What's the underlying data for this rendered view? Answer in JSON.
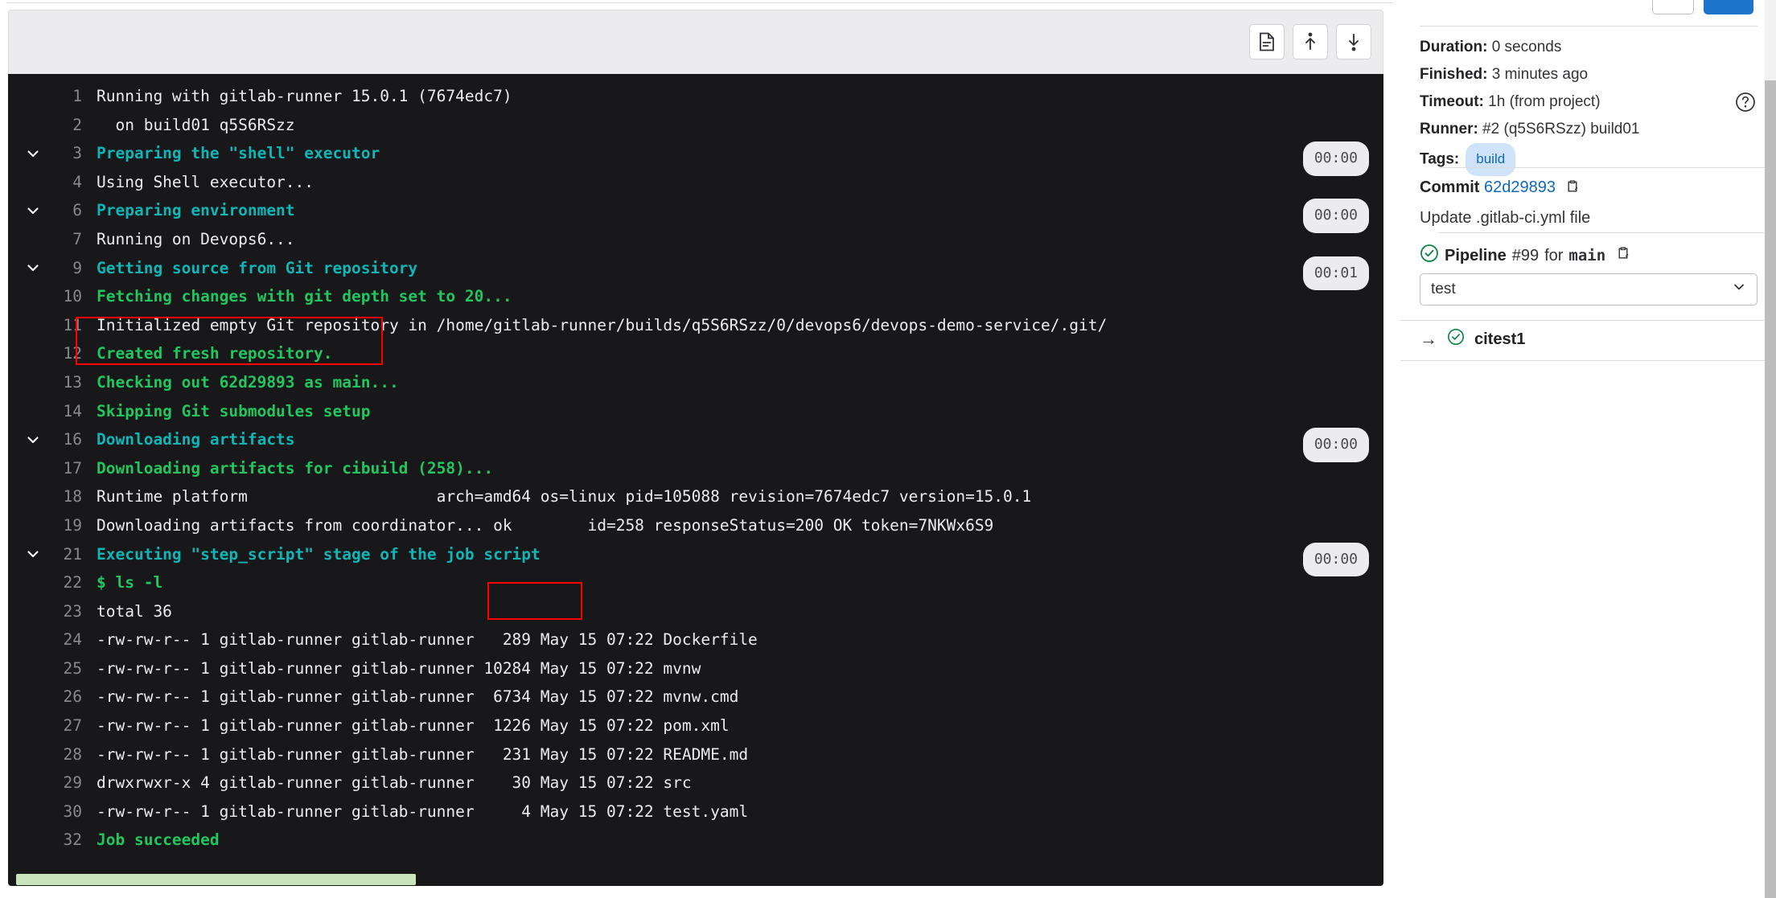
{
  "toolbar": {
    "buttons": [
      {
        "name": "raw-log-button",
        "icon": "document-icon",
        "label": "Show complete raw"
      },
      {
        "name": "scroll-to-top-button",
        "icon": "arrow-up-icon",
        "label": "Scroll to top"
      },
      {
        "name": "scroll-to-bottom-button",
        "icon": "arrow-down-icon",
        "label": "Scroll to bottom"
      }
    ]
  },
  "log": {
    "lines": [
      {
        "num": "1",
        "text": "Running with gitlab-runner 15.0.1 (7674edc7)",
        "style": "plain",
        "collapsible": false,
        "time": ""
      },
      {
        "num": "2",
        "text": "  on build01 q5S6RSzz",
        "style": "plain",
        "collapsible": false,
        "time": ""
      },
      {
        "num": "3",
        "text": "Preparing the \"shell\" executor",
        "style": "cyan",
        "collapsible": true,
        "time": "00:00"
      },
      {
        "num": "4",
        "text": "Using Shell executor...",
        "style": "plain",
        "collapsible": false,
        "time": ""
      },
      {
        "num": "6",
        "text": "Preparing environment",
        "style": "cyan",
        "collapsible": true,
        "time": "00:00"
      },
      {
        "num": "7",
        "text": "Running on Devops6...",
        "style": "plain",
        "collapsible": false,
        "time": ""
      },
      {
        "num": "9",
        "text": "Getting source from Git repository",
        "style": "cyan",
        "collapsible": true,
        "time": "00:01"
      },
      {
        "num": "10",
        "text": "Fetching changes with git depth set to 20...",
        "style": "green",
        "collapsible": false,
        "time": ""
      },
      {
        "num": "11",
        "text": "Initialized empty Git repository in /home/gitlab-runner/builds/q5S6RSzz/0/devops6/devops-demo-service/.git/",
        "style": "plain",
        "collapsible": false,
        "time": ""
      },
      {
        "num": "12",
        "text": "Created fresh repository.",
        "style": "green",
        "collapsible": false,
        "time": ""
      },
      {
        "num": "13",
        "text": "Checking out 62d29893 as main...",
        "style": "green",
        "collapsible": false,
        "time": ""
      },
      {
        "num": "14",
        "text": "Skipping Git submodules setup",
        "style": "green",
        "collapsible": false,
        "time": ""
      },
      {
        "num": "16",
        "text": "Downloading artifacts",
        "style": "cyan",
        "collapsible": true,
        "time": "00:00"
      },
      {
        "num": "17",
        "text": "Downloading artifacts for cibuild (258)...",
        "style": "green",
        "collapsible": false,
        "time": ""
      },
      {
        "num": "18",
        "text": "Runtime platform                    arch=amd64 os=linux pid=105088 revision=7674edc7 version=15.0.1",
        "style": "plain",
        "collapsible": false,
        "time": ""
      },
      {
        "num": "19",
        "text": "Downloading artifacts from coordinator... ok        id=258 responseStatus=200 OK token=7NKWx6S9",
        "style": "plain",
        "collapsible": false,
        "time": ""
      },
      {
        "num": "21",
        "text": "Executing \"step_script\" stage of the job script",
        "style": "cyan",
        "collapsible": true,
        "time": "00:00"
      },
      {
        "num": "22",
        "text": "$ ls -l",
        "style": "green",
        "collapsible": false,
        "time": ""
      },
      {
        "num": "23",
        "text": "total 36",
        "style": "plain",
        "collapsible": false,
        "time": ""
      },
      {
        "num": "24",
        "text": "-rw-rw-r-- 1 gitlab-runner gitlab-runner   289 May 15 07:22 Dockerfile",
        "style": "plain",
        "collapsible": false,
        "time": ""
      },
      {
        "num": "25",
        "text": "-rw-rw-r-- 1 gitlab-runner gitlab-runner 10284 May 15 07:22 mvnw",
        "style": "plain",
        "collapsible": false,
        "time": ""
      },
      {
        "num": "26",
        "text": "-rw-rw-r-- 1 gitlab-runner gitlab-runner  6734 May 15 07:22 mvnw.cmd",
        "style": "plain",
        "collapsible": false,
        "time": ""
      },
      {
        "num": "27",
        "text": "-rw-rw-r-- 1 gitlab-runner gitlab-runner  1226 May 15 07:22 pom.xml",
        "style": "plain",
        "collapsible": false,
        "time": ""
      },
      {
        "num": "28",
        "text": "-rw-rw-r-- 1 gitlab-runner gitlab-runner   231 May 15 07:22 README.md",
        "style": "plain",
        "collapsible": false,
        "time": ""
      },
      {
        "num": "29",
        "text": "drwxrwxr-x 4 gitlab-runner gitlab-runner    30 May 15 07:22 src",
        "style": "plain",
        "collapsible": false,
        "time": ""
      },
      {
        "num": "30",
        "text": "-rw-rw-r-- 1 gitlab-runner gitlab-runner     4 May 15 07:22 test.yaml",
        "style": "plain",
        "collapsible": false,
        "time": ""
      },
      {
        "num": "32",
        "text": "Job succeeded",
        "style": "green",
        "collapsible": false,
        "time": ""
      }
    ],
    "annotation_color": "#ff0000",
    "background": "#18181b",
    "scrollbar_color": "#c9e5bb"
  },
  "sidebar": {
    "details": [
      {
        "label": "Duration:",
        "value": " 0 seconds"
      },
      {
        "label": "Finished:",
        "value": " 3 minutes ago"
      },
      {
        "label": "Timeout:",
        "value": " 1h (from project)"
      },
      {
        "label": "Runner:",
        "value": " #2 (q5S6RSzz) build01"
      }
    ],
    "tags_label": "Tags:",
    "tags": [
      "build"
    ],
    "commit_label": "Commit",
    "commit_sha": "62d29893",
    "commit_message": "Update .gitlab-ci.yml file",
    "pipeline_label": "Pipeline",
    "pipeline_number": "#99",
    "pipeline_for": "for",
    "pipeline_ref": "main",
    "stage_selected": "test",
    "job_name": "citest1",
    "accent_blue": "#1f75cb",
    "tag_blue": "#1068bf",
    "success_green": "#108548"
  }
}
